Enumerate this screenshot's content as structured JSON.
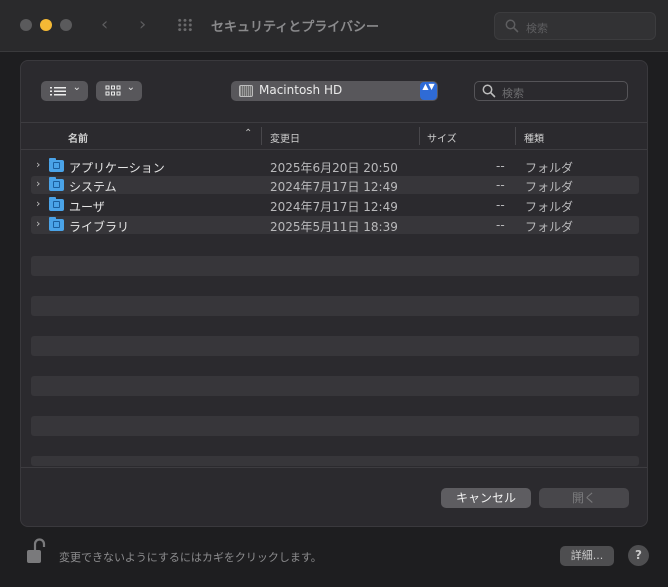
{
  "window": {
    "title": "セキュリティとプライバシー",
    "search_placeholder": "検索",
    "nav_back": "‹",
    "nav_forward": "›"
  },
  "sheet": {
    "view_chevron": "⌄",
    "location": "Macintosh HD",
    "location_stepper": "▲▼",
    "search_placeholder": "検索",
    "columns": {
      "name": "名前",
      "sort_indicator": "⌃",
      "date": "変更日",
      "size": "サイズ",
      "kind": "種類"
    },
    "rows": [
      {
        "name": "アプリケーション",
        "date": "2025年6月20日 20:50",
        "size": "--",
        "kind": "フォルダ"
      },
      {
        "name": "システム",
        "date": "2024年7月17日 12:49",
        "size": "--",
        "kind": "フォルダ"
      },
      {
        "name": "ユーザ",
        "date": "2024年7月17日 12:49",
        "size": "--",
        "kind": "フォルダ"
      },
      {
        "name": "ライブラリ",
        "date": "2025年5月11日 18:39",
        "size": "--",
        "kind": "フォルダ"
      }
    ],
    "cancel_label": "キャンセル",
    "open_label": "開く"
  },
  "footer": {
    "lock_text": "変更できないようにするにはカギをクリックします。",
    "details_label": "詳細...",
    "help_label": "?"
  },
  "colors": {
    "accent": "#2f6bd6",
    "folder": "#4aa3e8",
    "traffic_minimize": "#f5b935"
  },
  "icons": {
    "lock": "lock-open-icon",
    "folder": "folder-icon",
    "disk": "hard-disk-icon"
  }
}
